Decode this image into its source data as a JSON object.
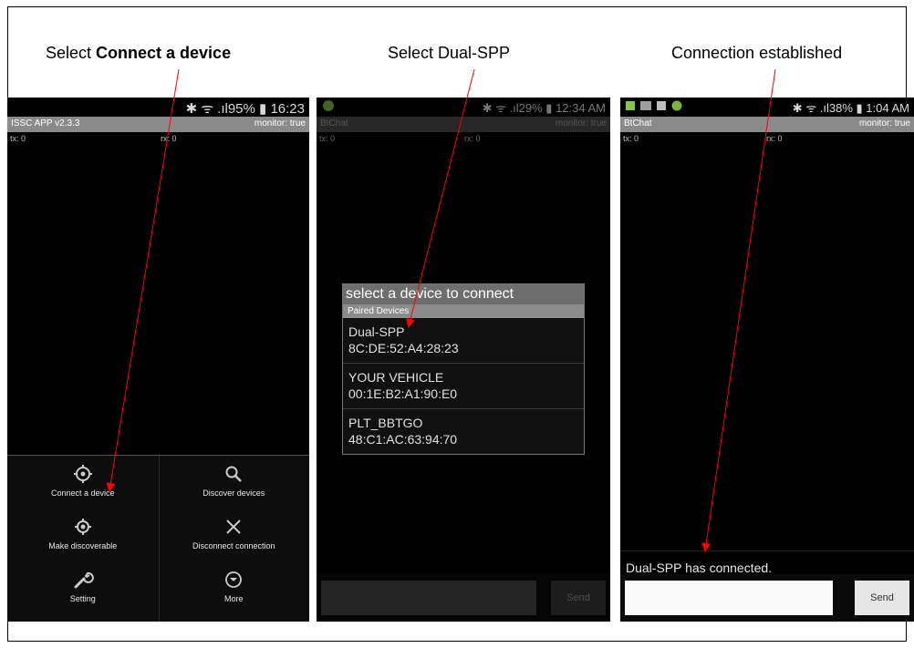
{
  "captions": {
    "c1_prefix": "Select ",
    "c1_bold": "Connect a device",
    "c2": "Select Dual-SPP",
    "c3": "Connection established"
  },
  "phone1": {
    "status_right": "✱ ᯤ .ıl95% ▮ 16:23",
    "title": "ISSC APP v2.3.3",
    "monitor": "monitor: true",
    "tx": "tx: 0",
    "rx": "rx: 0",
    "menu": [
      {
        "label": "Connect a device",
        "icon": "target-icon"
      },
      {
        "label": "Discover devices",
        "icon": "search-icon"
      },
      {
        "label": "Make discoverable",
        "icon": "radar-icon"
      },
      {
        "label": "Disconnect connection",
        "icon": "close-icon"
      },
      {
        "label": "Setting",
        "icon": "wrench-icon"
      },
      {
        "label": "More",
        "icon": "chevron-down-circle-icon"
      }
    ]
  },
  "phone2": {
    "status_right": "✱ ᯤ .ıl29% ▮ 12:34 AM",
    "title": "BtChat",
    "monitor": "monitor: true",
    "tx": "tx: 0",
    "rx": "rx: 0",
    "dialog_title": "select a device to connect",
    "dialog_subtitle": "Paired Devices",
    "devices": [
      {
        "name": "Dual-SPP",
        "address": "8C:DE:52:A4:28:23"
      },
      {
        "name": "YOUR VEHICLE",
        "address": "00:1E:B2:A1:90:E0"
      },
      {
        "name": "PLT_BBTGO",
        "address": "48:C1:AC:63:94:70"
      }
    ],
    "send": "Send"
  },
  "phone3": {
    "status_right": "✱ ᯤ .ıl38% ▮ 1:04 AM",
    "title": "BtChat",
    "monitor": "monitor: true",
    "tx": "tx: 0",
    "rx": "rx: 0",
    "message": "Dual-SPP has connected.",
    "send": "Send"
  },
  "colors": {
    "arrow": "#ff0000",
    "titlebar": "#8a8a8a"
  }
}
